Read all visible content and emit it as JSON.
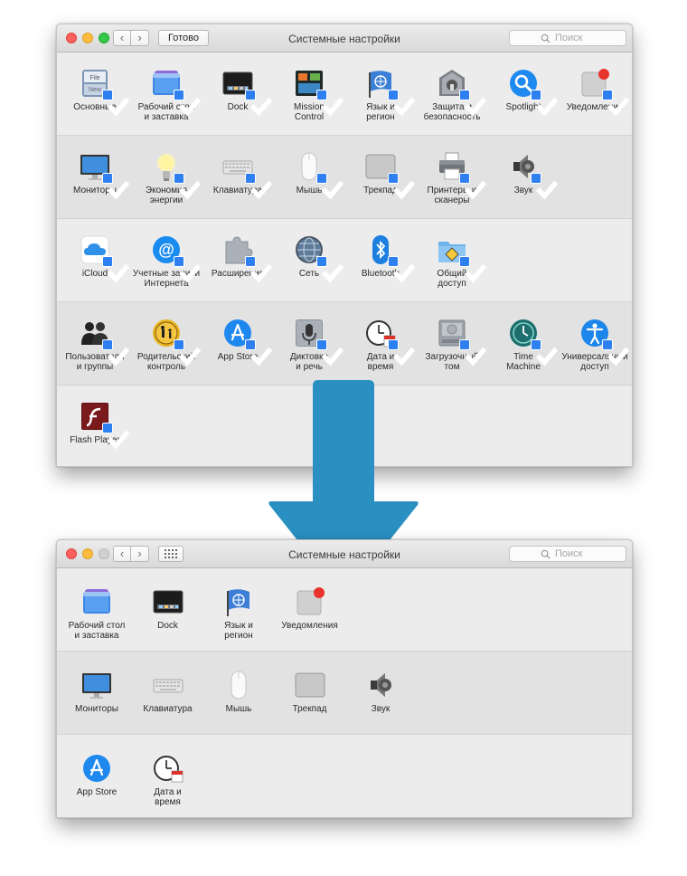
{
  "top_window": {
    "title": "Системные настройки",
    "done_label": "Готово",
    "search_placeholder": "Поиск",
    "rows": [
      [
        "Основные",
        "Рабочий стол\nи заставка",
        "Dock",
        "Mission\nControl",
        "Язык и\nрегион",
        "Защита и\nбезопасность",
        "Spotlight",
        "Уведомления"
      ],
      [
        "Мониторы",
        "Экономия\nэнергии",
        "Клавиатура",
        "Мышь",
        "Трекпад",
        "Принтеры и\nсканеры",
        "Звук"
      ],
      [
        "iCloud",
        "Учетные записи\nИнтернета",
        "Расширения",
        "Сеть",
        "Bluetooth",
        "Общий\nдоступ"
      ],
      [
        "Пользователи\nи группы",
        "Родительский\nконтроль",
        "App Store",
        "Диктовка\nи речь",
        "Дата и\nвремя",
        "Загрузочный\nтом",
        "Time\nMachine",
        "Универсальный\nдоступ"
      ],
      [
        "Flash Player"
      ]
    ]
  },
  "bottom_window": {
    "title": "Системные настройки",
    "search_placeholder": "Поиск",
    "rows": [
      [
        "Рабочий стол\nи заставка",
        "Dock",
        "Язык и\nрегион",
        "Уведомления"
      ],
      [
        "Мониторы",
        "Клавиатура",
        "Мышь",
        "Трекпад",
        "Звук"
      ],
      [
        "App Store",
        "Дата и\nвремя"
      ]
    ]
  },
  "icons": {
    "top": [
      [
        "general-icon",
        "desktop-icon",
        "dock-icon",
        "mission-control-icon",
        "language-region-icon",
        "security-icon",
        "spotlight-icon",
        "notifications-icon"
      ],
      [
        "displays-icon",
        "energy-saver-icon",
        "keyboard-icon",
        "mouse-icon",
        "trackpad-icon",
        "printers-icon",
        "sound-icon"
      ],
      [
        "icloud-icon",
        "internet-accounts-icon",
        "extensions-icon",
        "network-icon",
        "bluetooth-icon",
        "sharing-icon"
      ],
      [
        "users-groups-icon",
        "parental-controls-icon",
        "app-store-icon",
        "dictation-icon",
        "date-time-icon",
        "startup-disk-icon",
        "time-machine-icon",
        "accessibility-icon"
      ],
      [
        "flash-player-icon"
      ]
    ],
    "bottom": [
      [
        "desktop-icon",
        "dock-icon",
        "language-region-icon",
        "notifications-icon"
      ],
      [
        "displays-icon",
        "keyboard-icon",
        "mouse-icon",
        "trackpad-icon",
        "sound-icon"
      ],
      [
        "app-store-icon",
        "date-time-icon"
      ]
    ]
  },
  "colors": {
    "arrow": "#2a8fc1",
    "checkbox": "#2e7ff0",
    "close": "#fc605c",
    "minimize": "#fdbc40",
    "maximize": "#34c84a"
  }
}
